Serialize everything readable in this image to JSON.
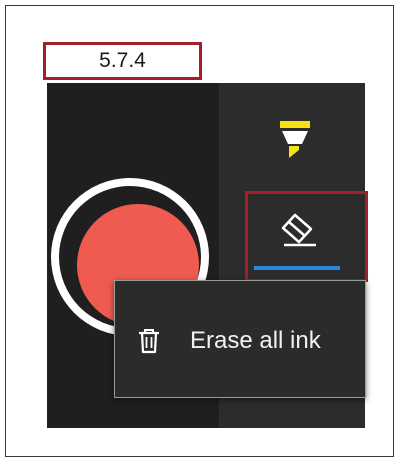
{
  "version_label": "5.7.4",
  "toolbar": {
    "highlighter_icon": "highlighter-icon",
    "eraser_icon": "eraser-icon",
    "record_icon": "record-button"
  },
  "context_menu": {
    "items": [
      {
        "label": "Erase all ink",
        "icon": "trash-icon"
      }
    ]
  },
  "colors": {
    "record": "#ef5b50",
    "highlighter": "#f5e20f",
    "selected_underline": "#2b88d8",
    "callout_border": "#a3202a"
  }
}
